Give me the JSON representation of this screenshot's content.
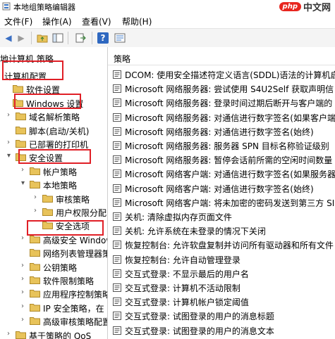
{
  "window": {
    "title": "本地组策略编辑器"
  },
  "watermark": {
    "logo": "php",
    "site": "中文网"
  },
  "menu": [
    "文件(F)",
    "操作(A)",
    "查看(V)",
    "帮助(H)"
  ],
  "toolbar": {
    "icons": [
      "back-icon",
      "forward-icon",
      "up-folder-icon",
      "show-hide-tree-icon",
      "export-list-icon",
      "help-icon",
      "properties-icon"
    ]
  },
  "tree": {
    "header": "地计算机 策略",
    "nodes": [
      {
        "label": "计算机配置",
        "indent": 0,
        "folder": false,
        "arrow": ""
      },
      {
        "label": "软件设置",
        "indent": 0,
        "folder": true,
        "arrow": ""
      },
      {
        "label": "Windows 设置",
        "indent": 0,
        "folder": true,
        "arrow": ""
      },
      {
        "label": "域名解析策略",
        "indent": 1,
        "folder": true,
        "arrow": ">"
      },
      {
        "label": "脚本(启动/关机)",
        "indent": 1,
        "folder": true,
        "arrow": ""
      },
      {
        "label": "已部署的打印机",
        "indent": 1,
        "folder": true,
        "arrow": ">"
      },
      {
        "label": "安全设置",
        "indent": 1,
        "folder": true,
        "arrow": "v"
      },
      {
        "label": "帐户策略",
        "indent": 2,
        "folder": true,
        "arrow": ">"
      },
      {
        "label": "本地策略",
        "indent": 2,
        "folder": true,
        "arrow": "v"
      },
      {
        "label": "审核策略",
        "indent": 3,
        "folder": true,
        "arrow": ">"
      },
      {
        "label": "用户权限分配",
        "indent": 3,
        "folder": true,
        "arrow": ">"
      },
      {
        "label": "安全选项",
        "indent": 3,
        "folder": true,
        "arrow": ""
      },
      {
        "label": "高级安全 Windows",
        "indent": 2,
        "folder": true,
        "arrow": ">"
      },
      {
        "label": "网络列表管理器策",
        "indent": 2,
        "folder": true,
        "arrow": ""
      },
      {
        "label": "公钥策略",
        "indent": 2,
        "folder": true,
        "arrow": ">"
      },
      {
        "label": "软件限制策略",
        "indent": 2,
        "folder": true,
        "arrow": ">"
      },
      {
        "label": "应用程序控制策略",
        "indent": 2,
        "folder": true,
        "arrow": ">"
      },
      {
        "label": "IP 安全策略，在",
        "indent": 2,
        "folder": true,
        "arrow": ">"
      },
      {
        "label": "高级审核策略配置",
        "indent": 2,
        "folder": true,
        "arrow": ">"
      },
      {
        "label": "基于策略的 QoS",
        "indent": 1,
        "folder": true,
        "arrow": ">"
      }
    ]
  },
  "policy": {
    "header": "策略",
    "rows": [
      "DCOM: 使用安全描述符定义语言(SDDL)语法的计算机启",
      "Microsoft 网络服务器: 尝试使用 S4U2Self 获取声明信",
      "Microsoft 网络服务器: 登录时间过期后断开与客户端的",
      "Microsoft 网络服务器: 对通信进行数字签名(如果客户端",
      "Microsoft 网络服务器: 对通信进行数字签名(始终)",
      "Microsoft 网络服务器: 服务器 SPN 目标名称验证级别",
      "Microsoft 网络服务器: 暂停会话前所需的空闲时间数量",
      "Microsoft 网络客户端: 对通信进行数字签名(如果服务器",
      "Microsoft 网络客户端: 对通信进行数字签名(始终)",
      "Microsoft 网络客户端: 将未加密的密码发送到第三方 SI",
      "关机: 清除虚拟内存页面文件",
      "关机: 允许系统在未登录的情况下关闭",
      "恢复控制台: 允许软盘复制并访问所有驱动器和所有文件",
      "恢复控制台: 允许自动管理登录",
      "交互式登录: 不显示最后的用户名",
      "交互式登录: 计算机不活动限制",
      "交互式登录: 计算机帐户锁定阈值",
      "交互式登录: 试图登录的用户的消息标题",
      "交互式登录: 试图登录的用户的消息文本"
    ]
  },
  "colors": {
    "highlight": "#e01f26",
    "folder": "#e8c35a",
    "selection": "#cce8ff"
  }
}
